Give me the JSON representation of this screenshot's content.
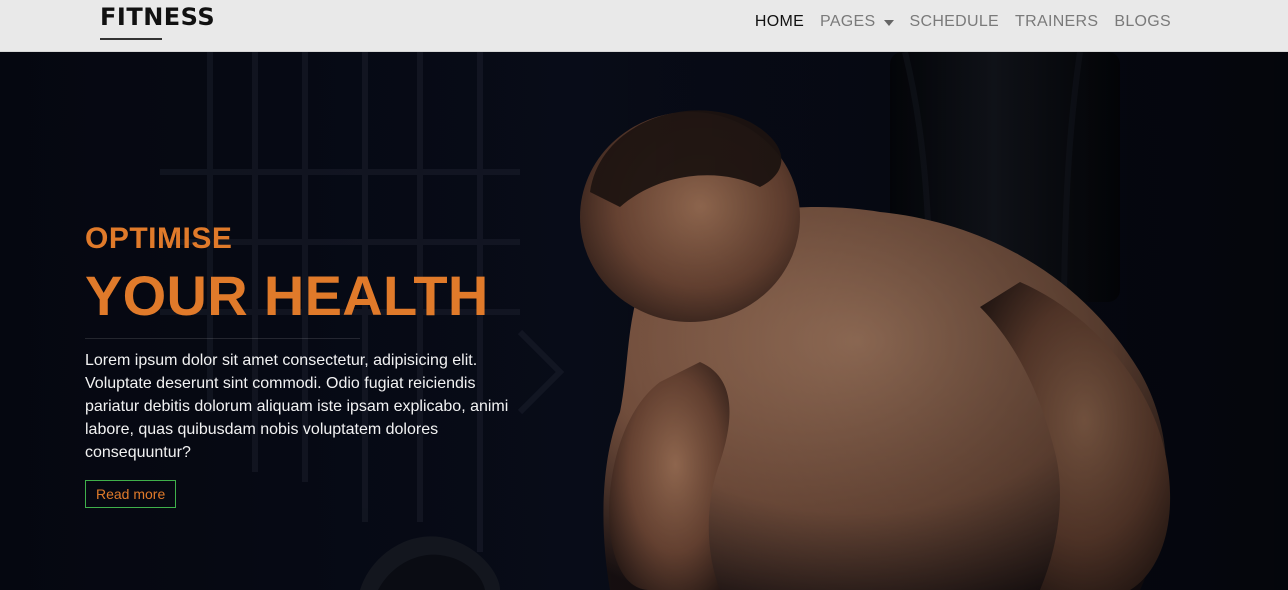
{
  "brand": {
    "text": "FITNESS"
  },
  "nav": {
    "items": [
      {
        "label": "HOME",
        "active": true
      },
      {
        "label": "PAGES",
        "has_caret": true
      },
      {
        "label": "SCHEDULE"
      },
      {
        "label": "TRAINERS"
      },
      {
        "label": "BLOGS"
      }
    ]
  },
  "hero": {
    "kicker": "OPTIMISE",
    "headline": "YOUR HEALTH",
    "body": "Lorem ipsum dolor sit amet consectetur, adipisicing elit. Voluptate deserunt sint commodi. Odio fugiat reiciendis pariatur debitis dolorum aliquam iste ipsam explicabo, animi labore, quas quibusdam nobis voluptatem dolores consequuntur?",
    "button_label": "Read more"
  },
  "colors": {
    "accent": "#e07a2a",
    "button_border": "#3fb04b",
    "topbar_bg": "#e9e9e9",
    "hero_bg": "#0b1020"
  }
}
